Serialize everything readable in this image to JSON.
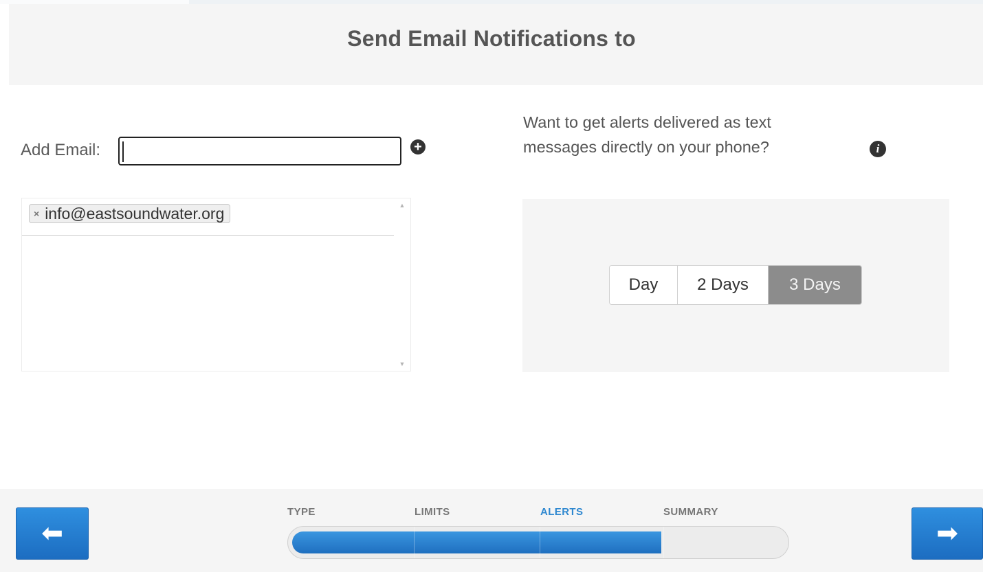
{
  "header": {
    "title": "Send Email Notifications to"
  },
  "email": {
    "add_label": "Add Email:",
    "input_value": "",
    "input_placeholder": "",
    "add_icon": "plus-circle-icon",
    "list": [
      {
        "address": "info@eastsoundwater.org",
        "remove_symbol": "×"
      }
    ],
    "scroll_up_symbol": "▲",
    "scroll_down_symbol": "▼"
  },
  "sms": {
    "question_line1": "Want to get alerts delivered as text",
    "question_line2": "messages directly on your phone?",
    "info_icon": "info-icon",
    "info_symbol": "i",
    "options": [
      {
        "label": "Day",
        "selected": false
      },
      {
        "label": "2 Days",
        "selected": false
      },
      {
        "label": "3 Days",
        "selected": true
      }
    ]
  },
  "footer": {
    "back_symbol": "🡄",
    "next_symbol": "🡆",
    "steps": [
      {
        "label": "TYPE",
        "active": false
      },
      {
        "label": "LIMITS",
        "active": false
      },
      {
        "label": "ALERTS",
        "active": true
      },
      {
        "label": "SUMMARY",
        "active": false
      }
    ],
    "progress_fraction": 0.75
  },
  "colors": {
    "accent": "#2f88d0",
    "selected_option_bg": "#8c8c8c",
    "panel_bg": "#f5f5f5"
  }
}
